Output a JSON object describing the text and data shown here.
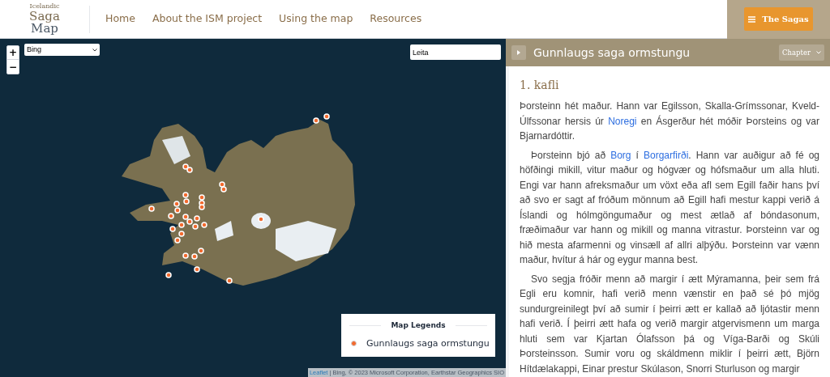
{
  "logo": {
    "top": "Icelandic",
    "middle": "Saga",
    "bottom": "Map"
  },
  "nav": [
    "Home",
    "About the ISM project",
    "Using the map",
    "Resources"
  ],
  "sagas_button": {
    "label": "The Sagas"
  },
  "map": {
    "zoom_in": "+",
    "zoom_out": "−",
    "layer_select": "Bing",
    "search": {
      "value": "Leita"
    },
    "legend": {
      "title": "Map Legends",
      "items": [
        {
          "label": "Gunnlaugs saga ormstungu",
          "color": "#f26a2e"
        }
      ]
    },
    "attribution": [
      {
        "text": "Leaflet",
        "link": true
      },
      {
        "text": " | Bing, © 2023 Microsoft Corporation, Earthstar Geographics SIO",
        "link": false
      }
    ]
  },
  "reader": {
    "title": "Gunnlaugs saga ormstungu",
    "chapter_select": "Chapter",
    "chapter_heading": "1. kafli",
    "paragraphs": [
      [
        {
          "text": "Þorsteinn hét maður. Hann var Egilsson, Skalla-Grímssonar, Kveld-Úlfssonar hersis úr ",
          "link": false
        },
        {
          "text": "Noregi",
          "link": true
        },
        {
          "text": " en Ásgerður hét móðir Þorsteins og var Bjarnardóttir.",
          "link": false
        }
      ],
      [
        {
          "text": "Þorsteinn bjó að ",
          "link": false
        },
        {
          "text": "Borg",
          "link": true
        },
        {
          "text": " í ",
          "link": false
        },
        {
          "text": "Borgarfirði",
          "link": true
        },
        {
          "text": ". Hann var auðigur að fé og höfðingi mikill, vitur maður og hógvær og hófsmaður um alla hluti. Engi var hann afreksmaður um vöxt eða afl sem Egill faðir hans því að svo er sagt af fróðum mönnum að Egill hafi mestur kappi verið á Íslandi og hólmgöngumaður og mest ætlað af bóndasonum, fræðimaður var hann og mikill og manna vitrastur. Þorsteinn var og hið mesta afarmenni og vinsæll af allri alþýðu. Þorsteinn var vænn maður, hvítur á hár og eygur manna best.",
          "link": false
        }
      ],
      [
        {
          "text": "Svo segja fróðir menn að margir í ætt Mýramanna, þeir sem frá Egli eru komnir, hafi verið menn vænstir en það sé þó mjög sundurgreinilegt því að sumir í þeirri ætt er kallað að ljótastir menn hafi verið. Í þeirri ætt hafa og verið margir atgervismenn um marga hluti sem var Kjartan Ólafsson þá og Víga-Barði og Skúli Þorsteinsson. Sumir voru og skáldmenn miklir í þeirri ætt, Björn Hítdælakappi, Einar prestur Skúlason, Snorri Sturluson og margir",
          "link": false
        }
      ]
    ]
  }
}
